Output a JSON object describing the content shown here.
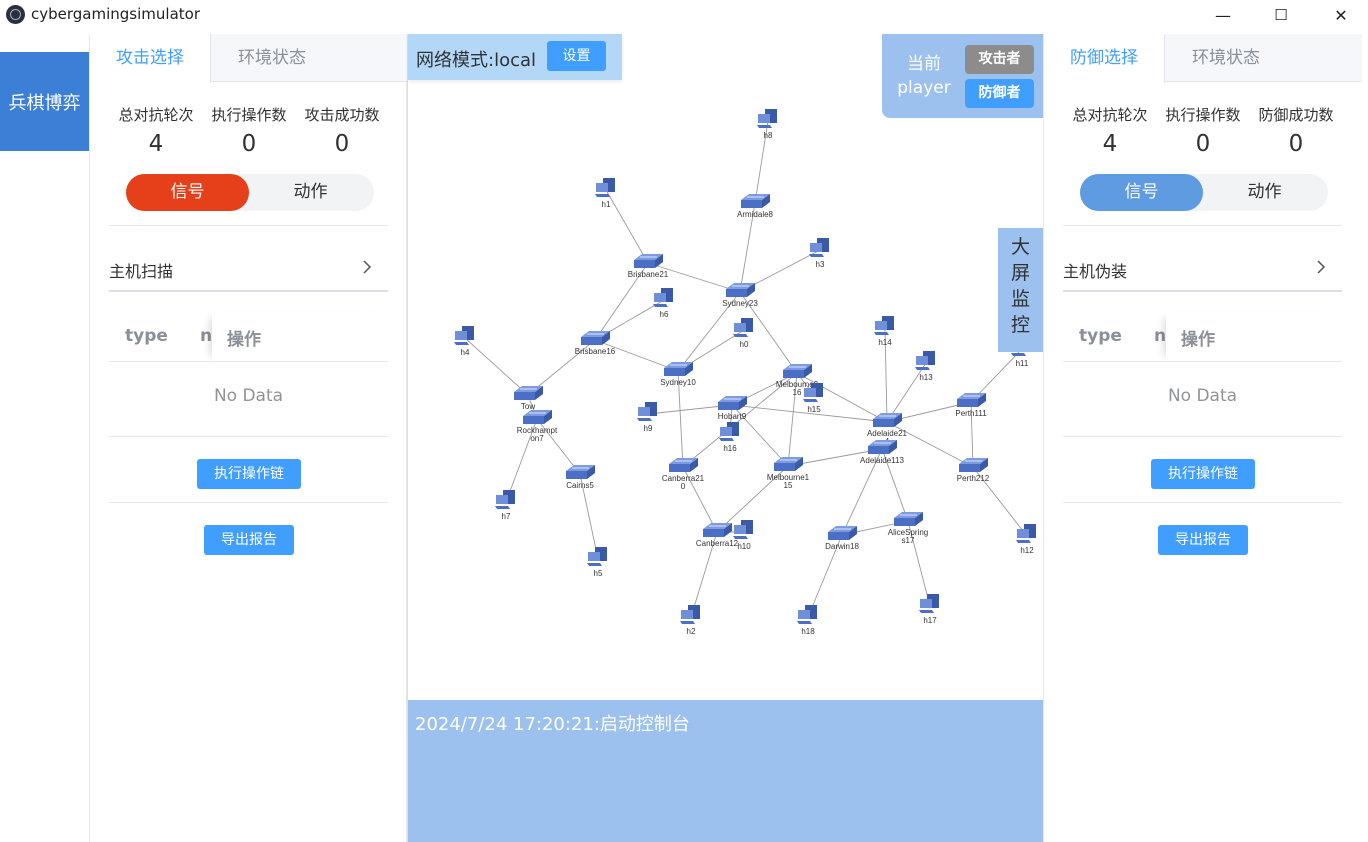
{
  "window": {
    "title": "cybergamingsimulator",
    "controls": [
      "—",
      "☐",
      "✕"
    ]
  },
  "nav": {
    "item": "兵棋博弈"
  },
  "attack_panel": {
    "tabs": [
      "攻击选择",
      "环境状态"
    ],
    "stats": [
      {
        "label": "总对抗轮次",
        "value": "4"
      },
      {
        "label": "执行操作数",
        "value": "0"
      },
      {
        "label": "攻击成功数",
        "value": "0"
      }
    ],
    "segment": {
      "options": [
        "信号",
        "动作"
      ],
      "active": "信号"
    },
    "action": "主机扫描",
    "table": {
      "columns": [
        "type",
        "na",
        "操作"
      ],
      "empty": "No Data"
    },
    "buttons": {
      "execute": "执行操作链",
      "export": "导出报告"
    }
  },
  "defense_panel": {
    "tabs": [
      "防御选择",
      "环境状态"
    ],
    "stats": [
      {
        "label": "总对抗轮次",
        "value": "4"
      },
      {
        "label": "执行操作数",
        "value": "0"
      },
      {
        "label": "防御成功数",
        "value": "0"
      }
    ],
    "segment": {
      "options": [
        "信号",
        "动作"
      ],
      "active": "信号"
    },
    "action": "主机伪装",
    "table": {
      "columns": [
        "type",
        "na",
        "操作"
      ],
      "empty": "No Data"
    },
    "buttons": {
      "execute": "执行操作链",
      "export": "导出报告"
    }
  },
  "center": {
    "network_mode": "网络模式:local",
    "settings_button": "设置",
    "player": {
      "label_line1": "当前",
      "label_line2": "player",
      "attacker": "攻击者",
      "defender": "防御者"
    },
    "monitor": [
      "大",
      "屏",
      "监",
      "控"
    ],
    "log": "2024/7/24 17:20:21:启动控制台"
  },
  "topology": {
    "routers": [
      {
        "id": "Armidale8",
        "label": [
          "Armidale8"
        ]
      },
      {
        "id": "Brisbane21",
        "label": [
          "Brisbane21"
        ]
      },
      {
        "id": "Sydney23",
        "label": [
          "Sydney23"
        ]
      },
      {
        "id": "Brisbane16",
        "label": [
          "Brisbane16"
        ]
      },
      {
        "id": "Sydney10",
        "label": [
          "Sydney10"
        ]
      },
      {
        "id": "Melbourne216",
        "label": [
          "Melbourne2",
          "16"
        ]
      },
      {
        "id": "Hobart9",
        "label": [
          "Hobart9"
        ]
      },
      {
        "id": "Townsville",
        "label": [
          "Tow"
        ]
      },
      {
        "id": "Rockhampton7",
        "label": [
          "Rockhampt",
          "on7"
        ]
      },
      {
        "id": "Cairns5",
        "label": [
          "Cairns5"
        ]
      },
      {
        "id": "Canberra210",
        "label": [
          "Canberra21",
          "0"
        ]
      },
      {
        "id": "Melbourne115",
        "label": [
          "Melbourne1",
          "15"
        ]
      },
      {
        "id": "Canberra12",
        "label": [
          "Canberra12"
        ]
      },
      {
        "id": "Adelaide214",
        "label": [
          "Adelaide21",
          "4"
        ]
      },
      {
        "id": "Adelaide113",
        "label": [
          "Adelaide113"
        ]
      },
      {
        "id": "Perth111",
        "label": [
          "Perth111"
        ]
      },
      {
        "id": "Perth212",
        "label": [
          "Perth212"
        ]
      },
      {
        "id": "Darwin18",
        "label": [
          "Darwin18"
        ]
      },
      {
        "id": "AliceSprings17",
        "label": [
          "AliceSpring",
          "s17"
        ]
      }
    ],
    "hosts": [
      "h8",
      "h1",
      "h3",
      "h6",
      "h0",
      "h4",
      "h14",
      "h13",
      "h15",
      "h9",
      "h16",
      "h7",
      "h10",
      "h5",
      "h2",
      "h18",
      "h17",
      "h12",
      "h11"
    ]
  },
  "colors": {
    "primary": "#409eff",
    "nav_blue": "#3c7fd6",
    "signal_active_attack": "#e6401a",
    "signal_active_defense": "#5e9be0",
    "player_panel": "#9dc1ee",
    "attacker_btn": "#8c8c8c",
    "network_mode_bg": "#b3d8f7",
    "router": "#4a6fc4"
  }
}
